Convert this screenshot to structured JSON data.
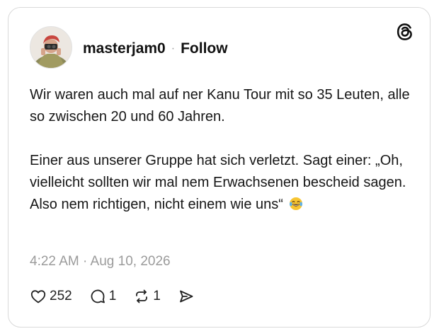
{
  "user": {
    "username": "masterjam0",
    "separator": "·",
    "follow_label": "Follow",
    "avatar_icon": "user-avatar-photo"
  },
  "brand": {
    "logo_icon": "threads-logo-icon"
  },
  "post": {
    "paragraph1": "Wir waren auch mal auf ner Kanu Tour mit so 35 Leuten, alle so zwischen 20 und 60 Jahren.",
    "paragraph2": "Einer aus unserer Gruppe hat sich verletzt. Sagt einer: „Oh, vielleicht sollten wir mal nem Erwachsenen bescheid sagen. Also nem richtigen, nicht einem wie uns“",
    "emoji_icon": "tears-of-joy-emoji-icon"
  },
  "timestamp": "4:22 AM · Aug 10, 2026",
  "actions": {
    "likes": "252",
    "replies": "1",
    "reposts": "1",
    "like_icon": "heart-icon",
    "reply_icon": "comment-bubble-icon",
    "repost_icon": "repost-icon",
    "share_icon": "send-icon"
  },
  "colors": {
    "text": "#161616",
    "muted": "#9b9b9b",
    "border": "#d9d9d9"
  }
}
